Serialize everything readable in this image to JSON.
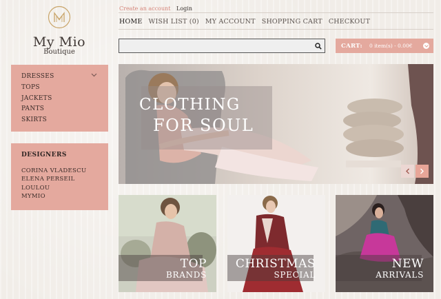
{
  "brand": {
    "name": "My Mio",
    "subtitle": "Boutique",
    "monogram": "MM"
  },
  "top_links": {
    "create_account": "Create an account",
    "login": "Login"
  },
  "nav": [
    {
      "label": "HOME",
      "active": true
    },
    {
      "label": "WISH LIST (0)",
      "active": false
    },
    {
      "label": "MY ACCOUNT",
      "active": false
    },
    {
      "label": "SHOPPING CART",
      "active": false
    },
    {
      "label": "CHECKOUT",
      "active": false
    }
  ],
  "search": {
    "value": "",
    "placeholder": "",
    "icon": "magnifier-icon"
  },
  "cart": {
    "label": "CART:",
    "summary": "0 item(s) - 0.00€",
    "toggle_icon": "chevron-down-icon"
  },
  "categories": [
    "DRESSES",
    "TOPS",
    "JACKETS",
    "PANTS",
    "SKIRTS"
  ],
  "designers": {
    "title": "DESIGNERS",
    "items": [
      "CORINA VLADESCU",
      "ELENA PERSEIL",
      "LOULOU",
      "MYMIO"
    ]
  },
  "hero": {
    "line1": "CLOTHING",
    "line2": "FOR SOUL",
    "prev_icon": "chevron-left-icon",
    "next_icon": "chevron-right-icon"
  },
  "promos": [
    {
      "line1": "TOP",
      "line2": "BRANDS"
    },
    {
      "line1": "CHRISTMAS",
      "line2": "SPECIAL"
    },
    {
      "line1": "NEW",
      "line2": "ARRIVALS"
    }
  ],
  "colors": {
    "accent": "#e4a99e",
    "link_accent": "#d58479",
    "background": "#f1ede8"
  }
}
